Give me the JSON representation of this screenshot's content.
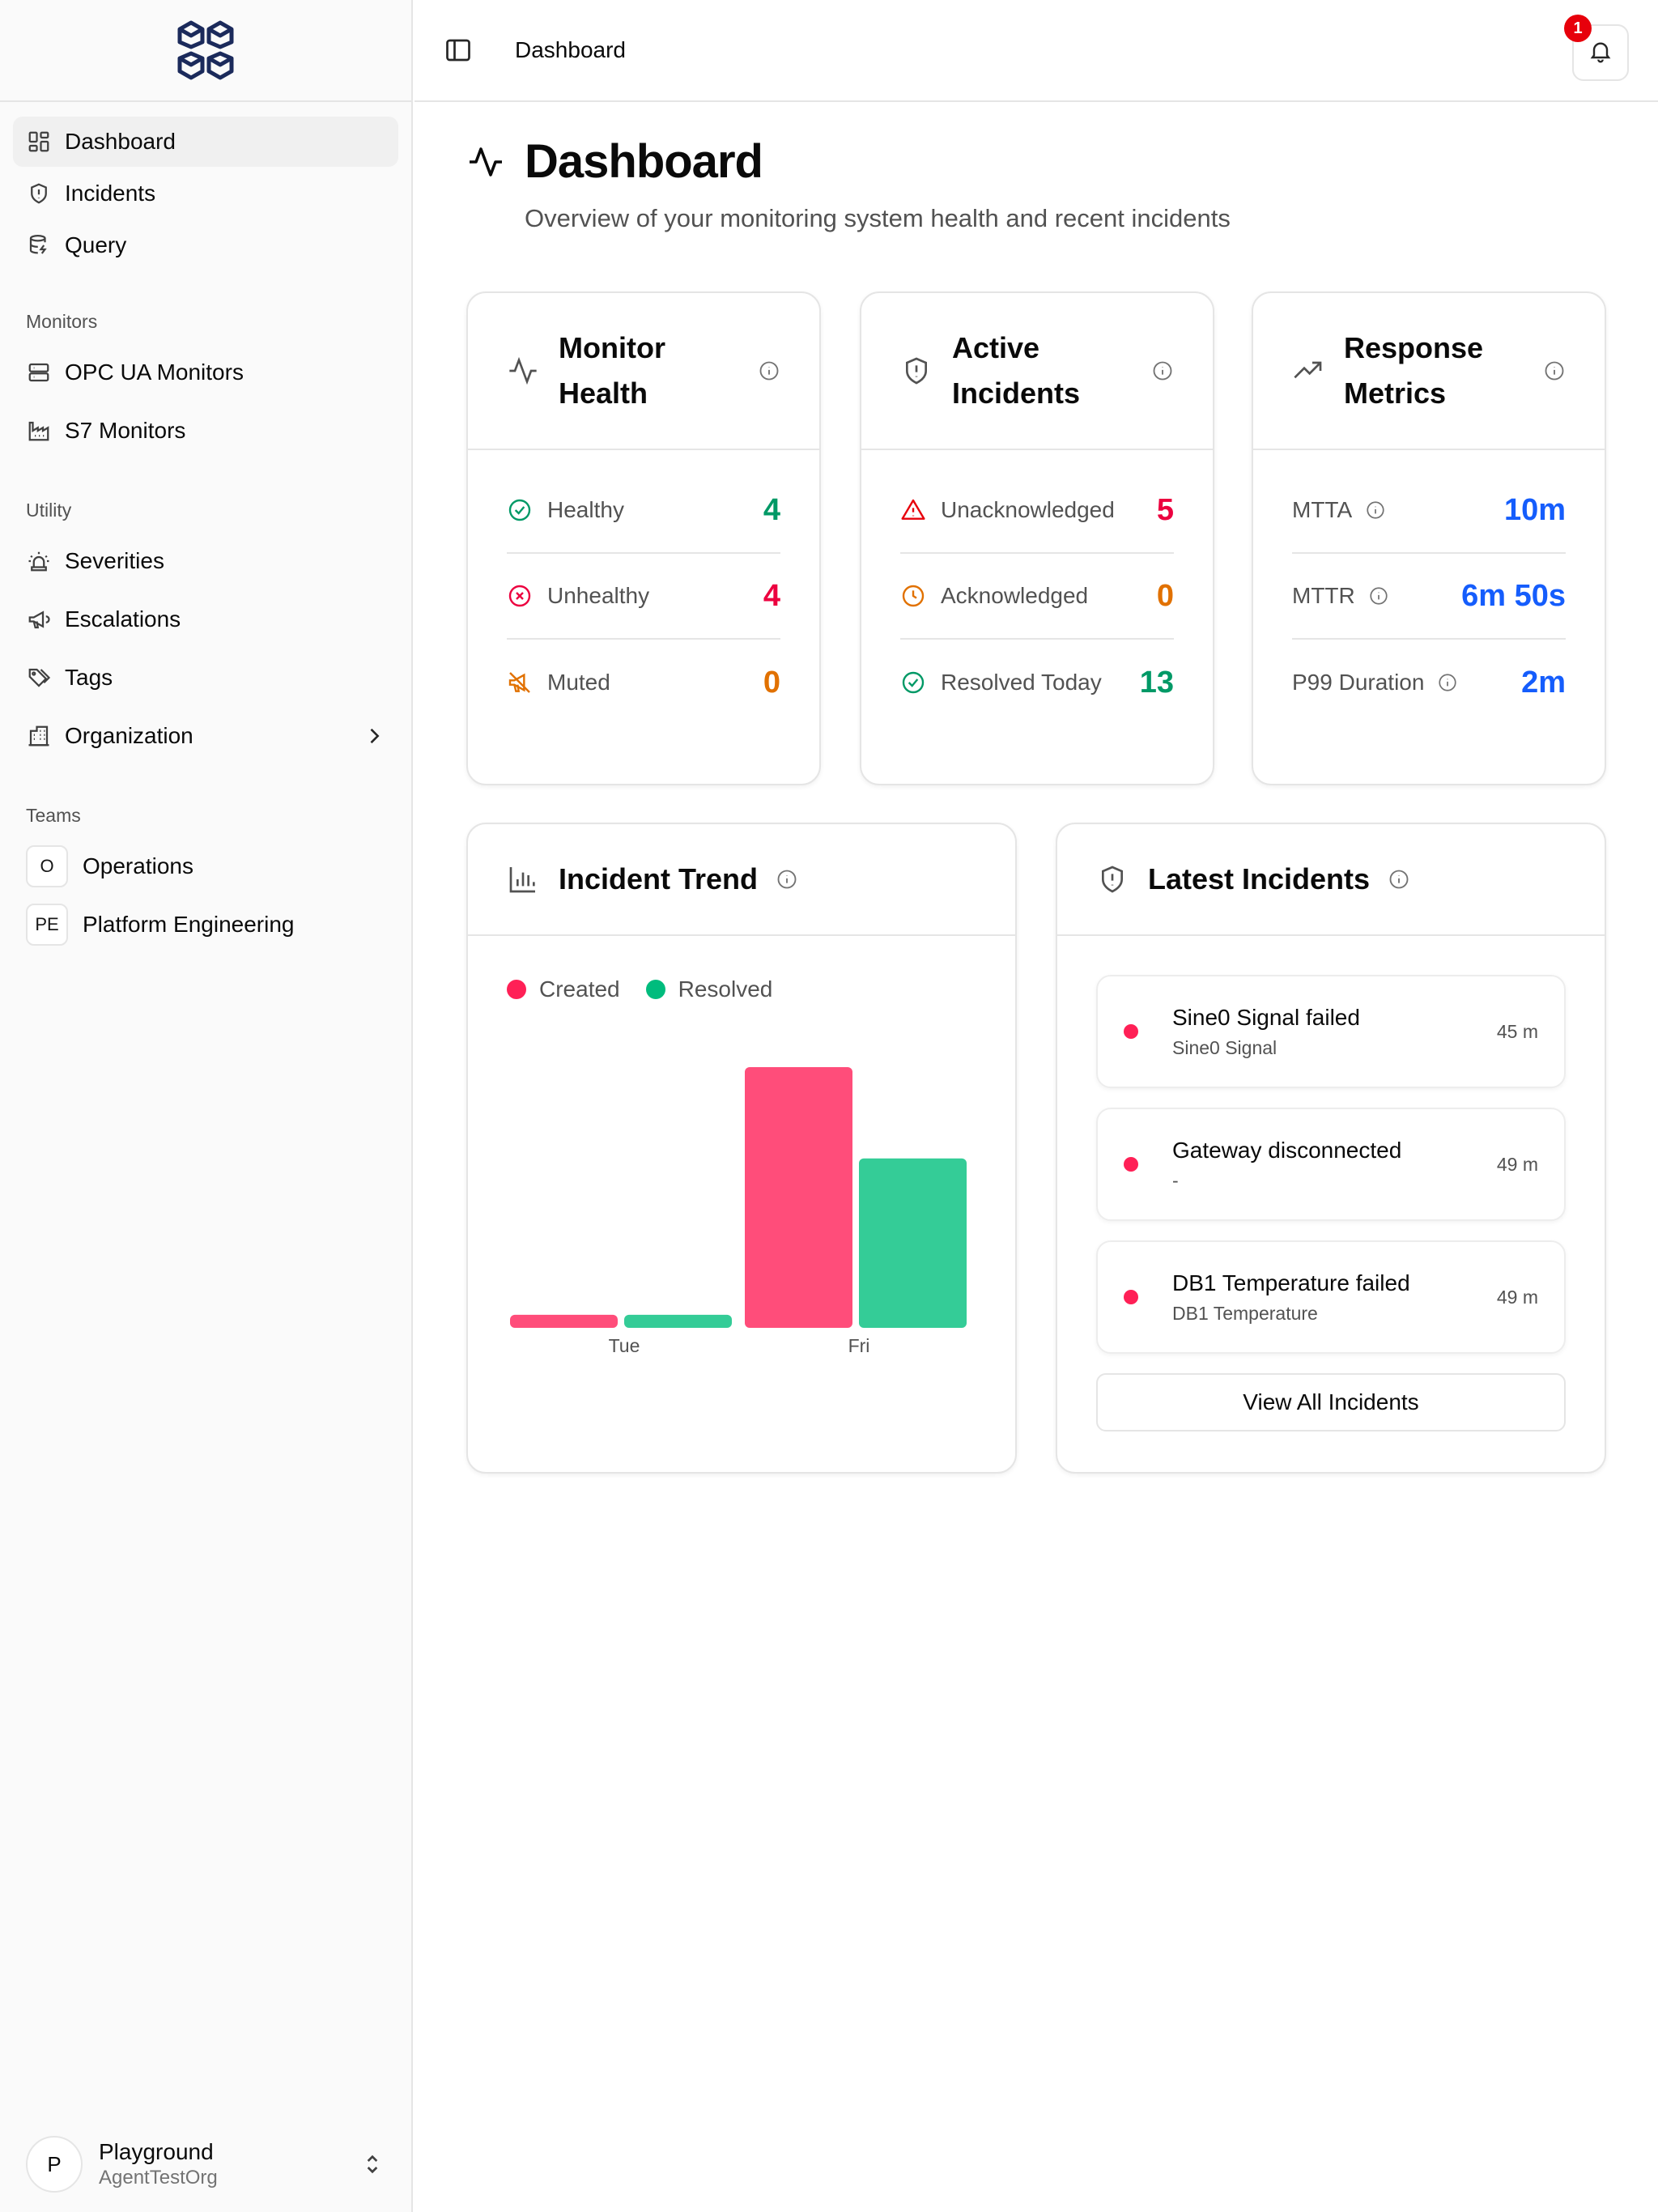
{
  "sidebar": {
    "nav": [
      {
        "label": "Dashboard",
        "icon": "layout-dashboard-icon",
        "active": true
      },
      {
        "label": "Incidents",
        "icon": "shield-alert-icon"
      },
      {
        "label": "Query",
        "icon": "database-search-icon"
      }
    ],
    "monitors_heading": "Monitors",
    "monitors": [
      {
        "label": "OPC UA Monitors",
        "icon": "server-icon"
      },
      {
        "label": "S7 Monitors",
        "icon": "factory-icon"
      }
    ],
    "utility_heading": "Utility",
    "utility": [
      {
        "label": "Severities",
        "icon": "siren-icon"
      },
      {
        "label": "Escalations",
        "icon": "megaphone-icon"
      },
      {
        "label": "Tags",
        "icon": "tags-icon"
      },
      {
        "label": "Organization",
        "icon": "building-icon"
      }
    ],
    "teams_heading": "Teams",
    "teams": [
      {
        "badge": "O",
        "label": "Operations"
      },
      {
        "badge": "PE",
        "label": "Platform Engineering"
      }
    ],
    "account": {
      "avatar": "P",
      "name": "Playground",
      "org": "AgentTestOrg"
    }
  },
  "topbar": {
    "breadcrumb": "Dashboard",
    "notification_count": "1"
  },
  "page": {
    "title": "Dashboard",
    "subtitle": "Overview of your monitoring system health and recent incidents"
  },
  "monitor_health": {
    "title_l1": "Monitor",
    "title_l2": "Health",
    "rows": [
      {
        "label": "Healthy",
        "value": "4",
        "color": "#009966"
      },
      {
        "label": "Unhealthy",
        "value": "4",
        "color": "#e7000b"
      },
      {
        "label": "Muted",
        "value": "0",
        "color": "#e17100"
      }
    ]
  },
  "active_incidents": {
    "title_l1": "Active",
    "title_l2": "Incidents",
    "rows": [
      {
        "label": "Unacknowledged",
        "value": "5",
        "color": "#e7000b"
      },
      {
        "label": "Acknowledged",
        "value": "0",
        "color": "#e17100"
      },
      {
        "label": "Resolved Today",
        "value": "13",
        "color": "#009966"
      }
    ]
  },
  "response_metrics": {
    "title_l1": "Response",
    "title_l2": "Metrics",
    "rows": [
      {
        "label": "MTTA",
        "value": "10m"
      },
      {
        "label": "MTTR",
        "value": "6m 50s"
      },
      {
        "label": "P99 Duration",
        "value": "2m"
      }
    ]
  },
  "incident_trend": {
    "title": "Incident Trend"
  },
  "chart_data": {
    "type": "bar",
    "categories": [
      "Tue",
      "Fri"
    ],
    "series": [
      {
        "name": "Created",
        "values": [
          1,
          20
        ],
        "color": "#ff4d7a"
      },
      {
        "name": "Resolved",
        "values": [
          1,
          13
        ],
        "color": "#34cc97"
      }
    ],
    "ylim": [
      0,
      20
    ],
    "grid": false,
    "legend": "top-left"
  },
  "latest_incidents": {
    "title": "Latest Incidents",
    "items": [
      {
        "title": "Sine0 Signal failed",
        "sub": "Sine0 Signal",
        "age": "45 m"
      },
      {
        "title": "Gateway disconnected",
        "sub": "-",
        "age": "49 m"
      },
      {
        "title": "DB1 Temperature failed",
        "sub": "DB1 Temperature",
        "age": "49 m"
      }
    ],
    "view_all": "View All Incidents"
  }
}
